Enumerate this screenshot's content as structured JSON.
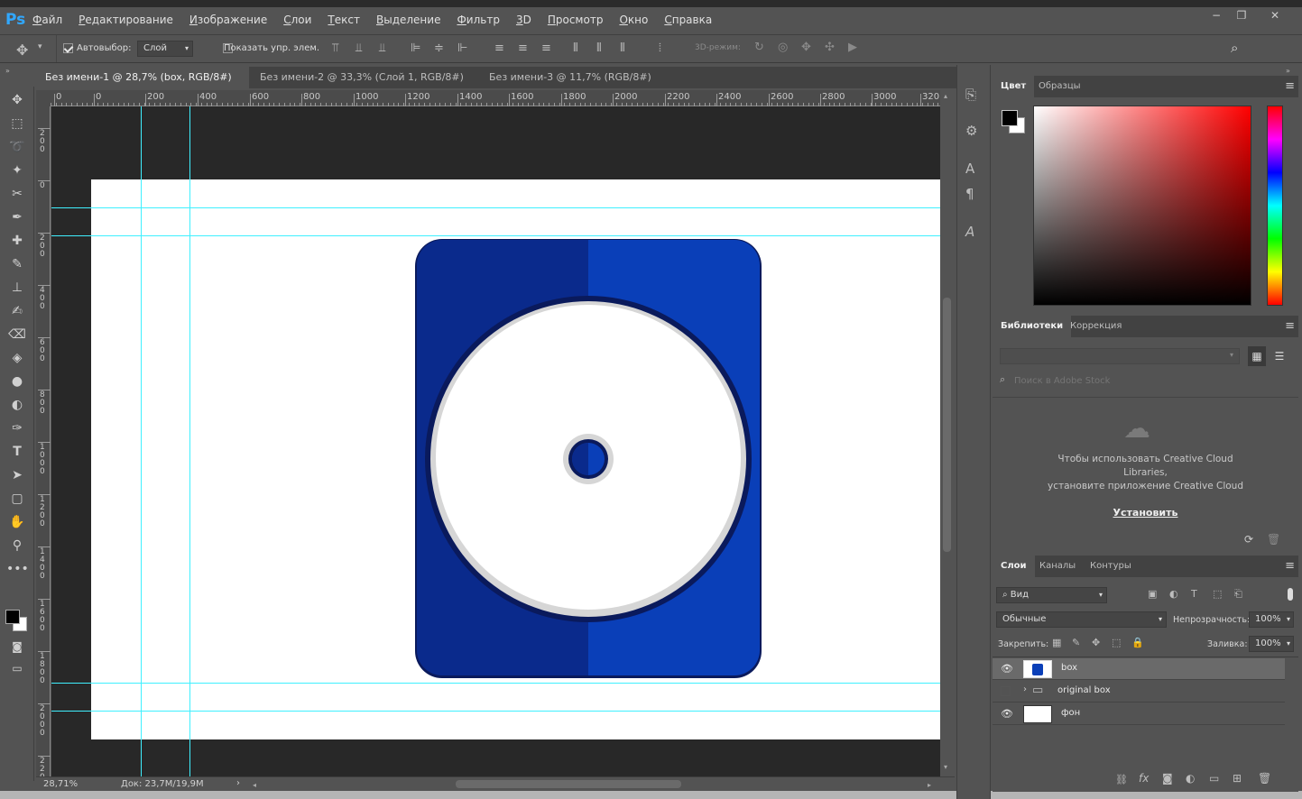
{
  "app": {
    "logo": "Ps"
  },
  "menu": [
    "Файл",
    "Редактирование",
    "Изображение",
    "Слои",
    "Текст",
    "Выделение",
    "Фильтр",
    "3D",
    "Просмотр",
    "Окно",
    "Справка"
  ],
  "window_controls": {
    "minimize": "−",
    "restore": "❐",
    "close": "✕"
  },
  "options": {
    "autoselect_label": "Автовыбор:",
    "autoselect_checked": true,
    "autoselect_value": "Слой",
    "show_controls_label": "Показать упр. элем.",
    "mode_3d_label": "3D-режим:"
  },
  "document_tabs": [
    {
      "label": "Без имени-1 @ 28,7% (box, RGB/8#) *",
      "active": true
    },
    {
      "label": "Без имени-2 @ 33,3% (Слой 1, RGB/8#) *",
      "active": false
    },
    {
      "label": "Без имени-3 @ 11,7% (RGB/8#) *",
      "active": false
    }
  ],
  "tab_close": "×",
  "ruler_top": [
    "0",
    "0",
    "200",
    "400",
    "600",
    "800",
    "1000",
    "1200",
    "1400",
    "1600",
    "1800",
    "2000",
    "2200",
    "2400",
    "2600",
    "2800",
    "3000",
    "320"
  ],
  "ruler_left": [
    "200",
    "0",
    "200",
    "400",
    "600",
    "800",
    "1000",
    "1200",
    "1400",
    "1600",
    "1800",
    "2000",
    "2200"
  ],
  "status": {
    "zoom": "28,71%",
    "doc": "Док: 23,7M/19,9M",
    "arrow": "›"
  },
  "color_panel": {
    "tabs": [
      "Цвет",
      "Образцы"
    ],
    "accent_colors": [
      "#ff0000",
      "#000000",
      "#ffffff"
    ]
  },
  "libraries_panel": {
    "tabs": [
      "Библиотеки",
      "Коррекция"
    ],
    "search_placeholder": "Поиск в Adobe Stock",
    "message_line1": "Чтобы использовать Creative Cloud",
    "message_line2": "Libraries,",
    "message_line3": "установите приложение Creative Cloud",
    "install_link": "Установить"
  },
  "layers_panel": {
    "tabs": [
      "Слои",
      "Каналы",
      "Контуры"
    ],
    "filter_label": "Вид",
    "blend_mode": "Обычные",
    "opacity_label": "Непрозрачность:",
    "opacity_value": "100%",
    "lock_label": "Закрепить:",
    "fill_label": "Заливка:",
    "fill_value": "100%",
    "layers": [
      {
        "name": "box",
        "visible": true,
        "selected": true
      },
      {
        "name": "original box",
        "visible": false,
        "selected": false,
        "group": true
      },
      {
        "name": "фон",
        "visible": true,
        "selected": false
      }
    ]
  },
  "artwork": {
    "box_dark": "#0a2a8c",
    "box_light": "#0a3fb8",
    "outline": "#0a1a5c",
    "disc": "#ffffff",
    "disc_rim": "#d6d6d6"
  }
}
